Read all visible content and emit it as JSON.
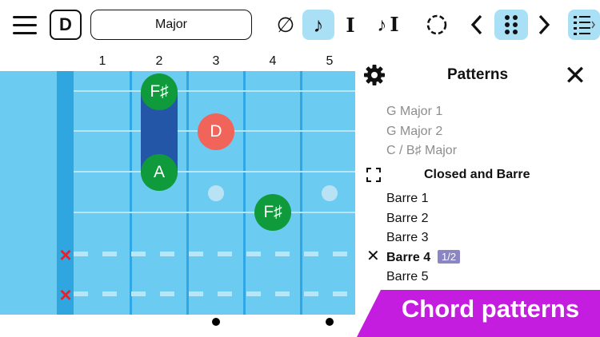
{
  "toolbar": {
    "key": "D",
    "scale": "Major",
    "icons": [
      "menu-icon",
      "no-chord-icon",
      "note-icon",
      "bar-icon",
      "note-bar-icon",
      "circle-icon",
      "prev-icon",
      "grid-dots-icon",
      "next-icon",
      "list-icon"
    ],
    "accent": "#a9e0f6"
  },
  "fretboard": {
    "fret_numbers": [
      "1",
      "2",
      "3",
      "4",
      "5"
    ],
    "notes": [
      {
        "label": "F♯",
        "color": "#0f9a3c"
      },
      {
        "label": "A",
        "color": "#0f9a3c"
      },
      {
        "label": "D",
        "color": "#f0645a"
      },
      {
        "label": "F♯",
        "color": "#0f9a3c"
      }
    ],
    "muted_strings": [
      "×",
      "×"
    ],
    "colors": {
      "board": "#6ccbf0",
      "barre": "#2456a8",
      "mute": "#e8222c"
    }
  },
  "patterns": {
    "title": "Patterns",
    "partial_item": "…",
    "items_a": [
      "G Major 1",
      "G Major 2",
      "C / B♯ Major"
    ],
    "section": "Closed and Barre",
    "items_b": [
      "Barre 1",
      "Barre 2",
      "Barre 3",
      "Barre 4",
      "Barre 5"
    ],
    "selected_badge": "1/2"
  },
  "banner": {
    "text": "Chord patterns",
    "color": "#c51de0"
  }
}
